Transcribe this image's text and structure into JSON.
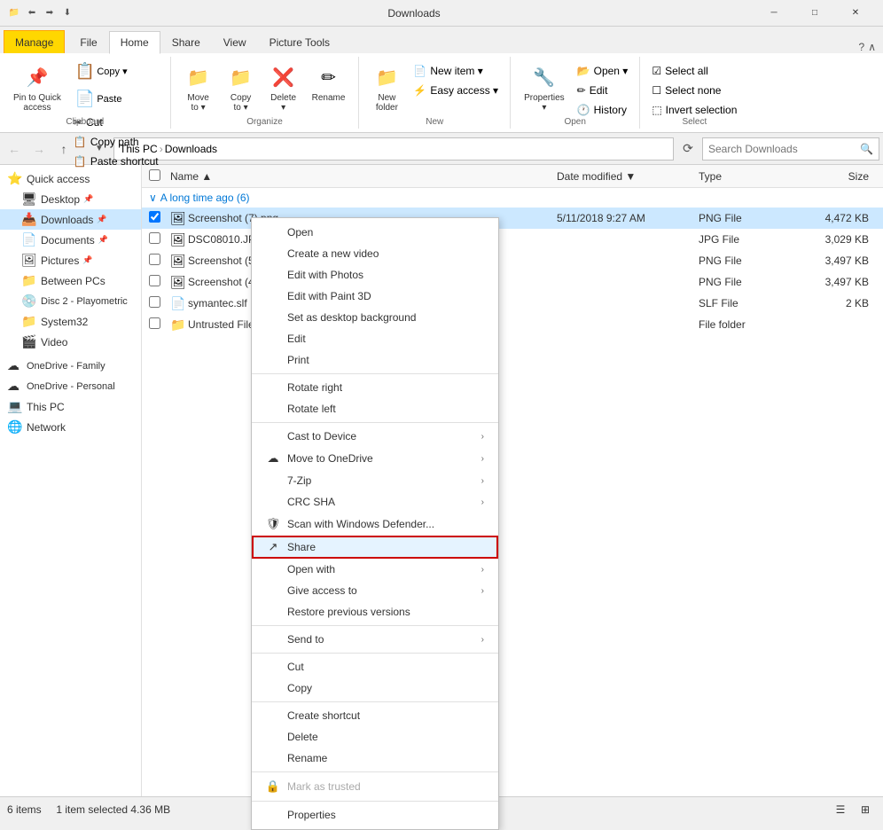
{
  "titlebar": {
    "icons": [
      "📁",
      "⬅",
      "➡"
    ],
    "title": "Downloads",
    "manage_tab": "Manage",
    "downloads_tab": "Downloads",
    "btn_minimize": "─",
    "btn_maximize": "□",
    "btn_close": "✕"
  },
  "ribbon": {
    "tabs": [
      "File",
      "Home",
      "Share",
      "View",
      "Picture Tools"
    ],
    "clipboard_group": "Clipboard",
    "clipboard_items": [
      {
        "label": "Pin to Quick\naccess",
        "icon": "📌"
      },
      {
        "label": "Copy",
        "icon": "📋"
      },
      {
        "label": "Paste",
        "icon": "📄"
      }
    ],
    "clipboard_small": [
      {
        "label": "Cut",
        "icon": "✂"
      },
      {
        "label": "Copy path",
        "icon": "📋"
      },
      {
        "label": "Paste shortcut",
        "icon": "📋"
      }
    ],
    "organize_group": "Organize",
    "organize_items": [
      {
        "label": "Move\nto ▾",
        "icon": "📁"
      },
      {
        "label": "Copy\nto ▾",
        "icon": "📁"
      },
      {
        "label": "Delete\n▾",
        "icon": "❌"
      },
      {
        "label": "Rename",
        "icon": "✏"
      }
    ],
    "new_group": "New",
    "new_items": [
      {
        "label": "New\nfolder",
        "icon": "📁"
      },
      {
        "label": "New item ▾",
        "icon": "📄"
      },
      {
        "label": "Easy access ▾",
        "icon": "⚡"
      }
    ],
    "open_group": "Open",
    "open_items": [
      {
        "label": "Properties\n▾",
        "icon": "🔧"
      },
      {
        "label": "Open ▾",
        "icon": "📂"
      },
      {
        "label": "Edit",
        "icon": "✏"
      },
      {
        "label": "History",
        "icon": "🕐"
      }
    ],
    "select_group": "Select",
    "select_items": [
      {
        "label": "Select all",
        "icon": ""
      },
      {
        "label": "Select none",
        "icon": ""
      },
      {
        "label": "Invert selection",
        "icon": ""
      }
    ]
  },
  "addressbar": {
    "back": "←",
    "forward": "→",
    "up": "↑",
    "refresh": "⟳",
    "path": [
      "This PC",
      "Downloads"
    ],
    "search_placeholder": "Search Downloads"
  },
  "sidebar": {
    "quick_access": "Quick access",
    "items": [
      {
        "label": "Desktop",
        "icon": "🖥",
        "indent": 1,
        "pinned": true
      },
      {
        "label": "Downloads",
        "icon": "📥",
        "indent": 1,
        "pinned": true,
        "active": true
      },
      {
        "label": "Documents",
        "icon": "📄",
        "indent": 1,
        "pinned": true
      },
      {
        "label": "Pictures",
        "icon": "🖼",
        "indent": 1,
        "pinned": true
      },
      {
        "label": "Between PCs",
        "icon": "📁",
        "indent": 1
      },
      {
        "label": "Disc 2 - Playometric",
        "icon": "💿",
        "indent": 1
      },
      {
        "label": "System32",
        "icon": "📁",
        "indent": 1
      },
      {
        "label": "Video",
        "icon": "🎬",
        "indent": 1
      },
      {
        "label": "OneDrive - Family",
        "icon": "☁",
        "indent": 0
      },
      {
        "label": "OneDrive - Personal",
        "icon": "☁",
        "indent": 0
      },
      {
        "label": "This PC",
        "icon": "💻",
        "indent": 0
      },
      {
        "label": "Network",
        "icon": "🌐",
        "indent": 0
      }
    ]
  },
  "filelist": {
    "columns": [
      "Name",
      "Date modified",
      "Type",
      "Size"
    ],
    "group_label": "A long time ago (6)",
    "files": [
      {
        "name": "Screenshot (7).png",
        "date": "5/11/2018 9:27 AM",
        "type": "PNG File",
        "size": "4,472 KB",
        "selected": true,
        "checked": true
      },
      {
        "name": "DSC08010.JPG",
        "date": "",
        "type": "JPG File",
        "size": "3,029 KB",
        "selected": false,
        "checked": false
      },
      {
        "name": "Screenshot (5)...",
        "date": "",
        "type": "PNG File",
        "size": "3,497 KB",
        "selected": false,
        "checked": false
      },
      {
        "name": "Screenshot (4)...",
        "date": "",
        "type": "PNG File",
        "size": "3,497 KB",
        "selected": false,
        "checked": false
      },
      {
        "name": "symantec.slf",
        "date": "",
        "type": "SLF File",
        "size": "2 KB",
        "selected": false,
        "checked": false
      },
      {
        "name": "Untrusted File...",
        "date": "",
        "type": "File folder",
        "size": "",
        "selected": false,
        "checked": false
      }
    ]
  },
  "context_menu": {
    "items": [
      {
        "label": "Open",
        "icon": "",
        "separator_after": false,
        "has_arrow": false
      },
      {
        "label": "Create a new video",
        "icon": "",
        "separator_after": false,
        "has_arrow": false
      },
      {
        "label": "Edit with Photos",
        "icon": "",
        "separator_after": false,
        "has_arrow": false
      },
      {
        "label": "Edit with Paint 3D",
        "icon": "",
        "separator_after": false,
        "has_arrow": false
      },
      {
        "label": "Set as desktop background",
        "icon": "",
        "separator_after": false,
        "has_arrow": false
      },
      {
        "label": "Edit",
        "icon": "",
        "separator_after": false,
        "has_arrow": false
      },
      {
        "label": "Print",
        "icon": "",
        "separator_after": true,
        "has_arrow": false
      },
      {
        "label": "Rotate right",
        "icon": "",
        "separator_after": false,
        "has_arrow": false
      },
      {
        "label": "Rotate left",
        "icon": "",
        "separator_after": true,
        "has_arrow": false
      },
      {
        "label": "Cast to Device",
        "icon": "",
        "separator_after": false,
        "has_arrow": true
      },
      {
        "label": "Move to OneDrive",
        "icon": "☁",
        "separator_after": false,
        "has_arrow": true
      },
      {
        "label": "7-Zip",
        "icon": "",
        "separator_after": false,
        "has_arrow": true
      },
      {
        "label": "CRC SHA",
        "icon": "",
        "separator_after": false,
        "has_arrow": true
      },
      {
        "label": "Scan with Windows Defender...",
        "icon": "🛡",
        "separator_after": false,
        "has_arrow": false
      },
      {
        "label": "Share",
        "icon": "↗",
        "separator_after": false,
        "has_arrow": false,
        "highlighted": true
      },
      {
        "label": "Open with",
        "icon": "",
        "separator_after": false,
        "has_arrow": true
      },
      {
        "label": "Give access to",
        "icon": "",
        "separator_after": false,
        "has_arrow": true
      },
      {
        "label": "Restore previous versions",
        "icon": "",
        "separator_after": true,
        "has_arrow": false
      },
      {
        "label": "Send to",
        "icon": "",
        "separator_after": true,
        "has_arrow": true
      },
      {
        "label": "Cut",
        "icon": "",
        "separator_after": false,
        "has_arrow": false
      },
      {
        "label": "Copy",
        "icon": "",
        "separator_after": true,
        "has_arrow": false
      },
      {
        "label": "Create shortcut",
        "icon": "",
        "separator_after": false,
        "has_arrow": false
      },
      {
        "label": "Delete",
        "icon": "",
        "separator_after": false,
        "has_arrow": false
      },
      {
        "label": "Rename",
        "icon": "",
        "separator_after": true,
        "has_arrow": false
      },
      {
        "label": "Mark as trusted",
        "icon": "🔒",
        "separator_after": true,
        "has_arrow": false,
        "disabled": true
      },
      {
        "label": "Properties",
        "icon": "",
        "separator_after": false,
        "has_arrow": false
      }
    ]
  },
  "statusbar": {
    "items_count": "6 items",
    "selected": "1 item selected  4.36 MB"
  }
}
